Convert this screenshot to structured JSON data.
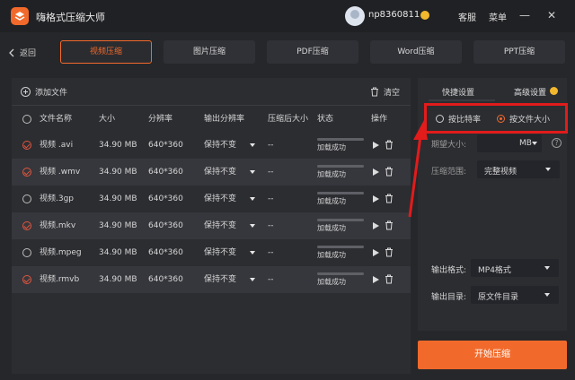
{
  "app": {
    "title": "嗨格式压缩大师",
    "username": "np8360811",
    "service": "客服",
    "menu": "菜单"
  },
  "nav": {
    "back": "返回",
    "tabs": [
      {
        "label": "视频压缩",
        "active": true
      },
      {
        "label": "图片压缩",
        "active": false
      },
      {
        "label": "PDF压缩",
        "active": false
      },
      {
        "label": "Word压缩",
        "active": false
      },
      {
        "label": "PPT压缩",
        "active": false
      }
    ]
  },
  "toolbar": {
    "add_file": "添加文件",
    "clear": "清空"
  },
  "table": {
    "headers": {
      "name": "文件名称",
      "size": "大小",
      "resolution": "分辨率",
      "out_resolution": "输出分辨率",
      "compressed_size": "压缩后大小",
      "status": "状态",
      "actions": "操作"
    },
    "rows": [
      {
        "name": "视频 .avi",
        "size": "34.90 MB",
        "resolution": "640*360",
        "out_resolution": "保持不变",
        "compressed_size": "--",
        "status": "加载成功",
        "checked": true
      },
      {
        "name": "视频 .wmv",
        "size": "34.90 MB",
        "resolution": "640*360",
        "out_resolution": "保持不变",
        "compressed_size": "--",
        "status": "加载成功",
        "checked": true
      },
      {
        "name": "视频.3gp",
        "size": "34.90 MB",
        "resolution": "640*360",
        "out_resolution": "保持不变",
        "compressed_size": "--",
        "status": "加载成功",
        "checked": false
      },
      {
        "name": "视频.mkv",
        "size": "34.90 MB",
        "resolution": "640*360",
        "out_resolution": "保持不变",
        "compressed_size": "--",
        "status": "加载成功",
        "checked": true
      },
      {
        "name": "视频.mpeg",
        "size": "34.90 MB",
        "resolution": "640*360",
        "out_resolution": "保持不变",
        "compressed_size": "--",
        "status": "加载成功",
        "checked": false
      },
      {
        "name": "视频.rmvb",
        "size": "34.90 MB",
        "resolution": "640*360",
        "out_resolution": "保持不变",
        "compressed_size": "--",
        "status": "加载成功",
        "checked": true
      }
    ]
  },
  "settings": {
    "quick_tab": "快捷设置",
    "advanced_tab": "高级设置",
    "mode_bitrate": "按比特率",
    "mode_filesize": "按文件大小",
    "selected_mode": "filesize",
    "expected_size_label": "期望大小:",
    "expected_size_unit": "MB",
    "range_label": "压缩范围:",
    "range_value": "完整视频",
    "format_label": "输出格式:",
    "format_value": "MP4格式",
    "dir_label": "输出目录:",
    "dir_value": "原文件目录",
    "start_button": "开始压缩"
  },
  "colors": {
    "accent": "#f26a2b",
    "annotation": "#e21b1b",
    "vip_badge": "#f2b82d"
  }
}
